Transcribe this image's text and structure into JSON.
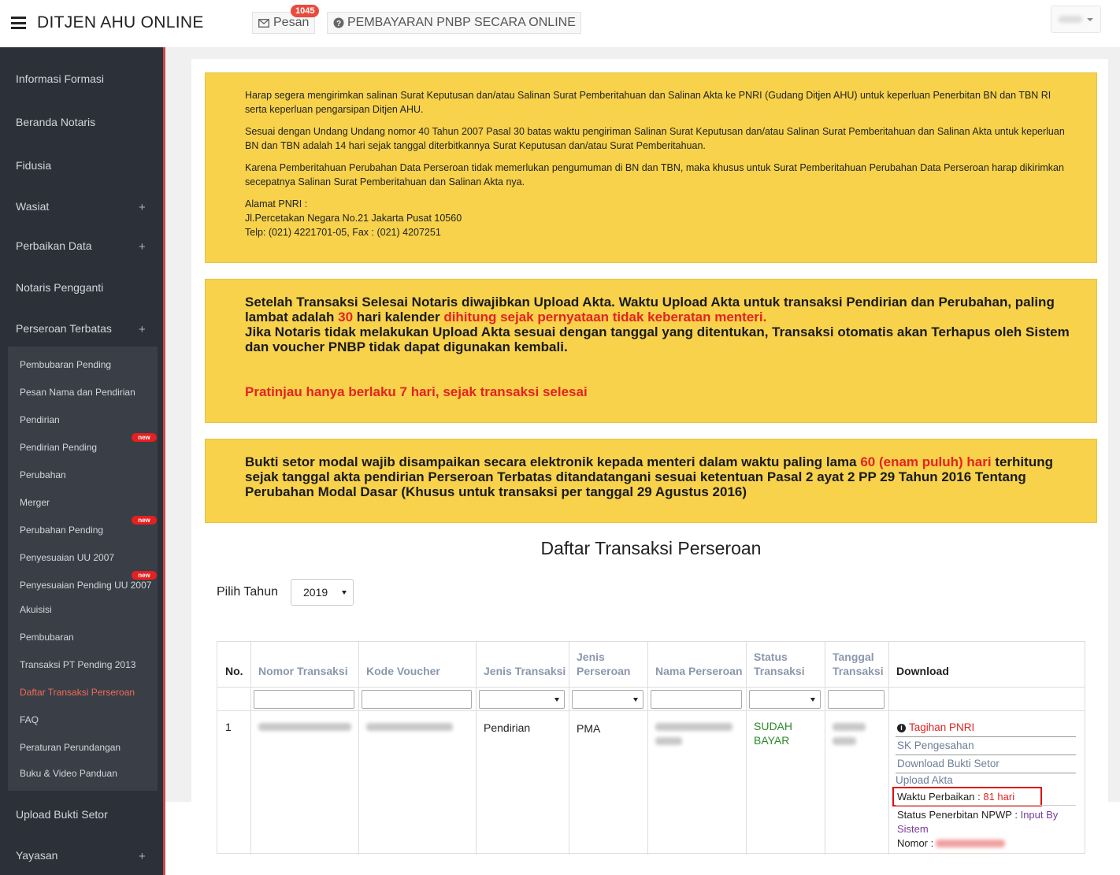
{
  "header": {
    "brand": "DITJEN AHU ONLINE",
    "messages_label": "Pesan",
    "messages_count": "1045",
    "pnbp_label": "PEMBAYARAN PNBP SECARA ONLINE"
  },
  "sidebar": {
    "items": [
      {
        "label": "Informasi Formasi"
      },
      {
        "label": "Beranda Notaris"
      },
      {
        "label": "Fidusia"
      },
      {
        "label": "Wasiat",
        "expand": "+"
      },
      {
        "label": "Perbaikan Data",
        "expand": "+"
      },
      {
        "label": "Notaris Pengganti"
      },
      {
        "label": "Perseroan Terbatas",
        "expand": "+"
      }
    ],
    "submenu": [
      {
        "label": "Pembubaran Pending"
      },
      {
        "label": "Pesan Nama dan Pendirian"
      },
      {
        "label": "Pendirian"
      },
      {
        "label": "Pendirian Pending",
        "badge": "new"
      },
      {
        "label": "Perubahan"
      },
      {
        "label": "Merger"
      },
      {
        "label": "Perubahan Pending",
        "badge": "new"
      },
      {
        "label": "Penyesuaian UU 2007"
      },
      {
        "label": "Penyesuaian Pending UU 2007",
        "badge": "new"
      },
      {
        "label": "Akuisisi"
      },
      {
        "label": "Pembubaran"
      },
      {
        "label": "Transaksi PT Pending 2013"
      },
      {
        "label": "Daftar Transaksi Perseroan",
        "active": true
      },
      {
        "label": "FAQ"
      },
      {
        "label": "Peraturan Perundangan"
      },
      {
        "label": "Buku & Video Panduan"
      }
    ],
    "after": [
      {
        "label": "Upload Bukti Setor"
      },
      {
        "label": "Yayasan",
        "expand": "+"
      }
    ]
  },
  "notice1": {
    "p1": "Harap segera mengirimkan salinan Surat Keputusan dan/atau Salinan Surat Pemberitahuan dan Salinan Akta ke PNRI (Gudang Ditjen AHU) untuk keperluan Penerbitan BN dan TBN RI serta keperluan pengarsipan Ditjen AHU.",
    "p2": "Sesuai dengan Undang Undang nomor 40 Tahun 2007 Pasal 30 batas waktu pengiriman Salinan Surat Keputusan dan/atau Salinan Surat Pemberitahuan dan Salinan Akta untuk keperluan BN dan TBN adalah 14 hari sejak tanggal diterbitkannya Surat Keputusan dan/atau Surat Pemberitahuan.",
    "p3": "Karena Pemberitahuan Perubahan Data Perseroan tidak memerlukan pengumuman di BN dan TBN, maka khusus untuk Surat Pemberitahuan Perubahan Data Perseroan harap dikirimkan secepatnya Salinan Surat Pemberitahuan dan Salinan Akta nya.",
    "addr_title": "Alamat PNRI :",
    "addr_line1": "Jl.Percetakan Negara No.21 Jakarta Pusat 10560",
    "addr_line2": "Telp: (021) 4221701-05, Fax : (021) 4207251"
  },
  "notice2": {
    "t1": "Setelah Transaksi Selesai Notaris diwajibkan Upload Akta. Waktu Upload Akta untuk transaksi Pendirian dan Perubahan, paling lambat adalah ",
    "t_days": "30",
    "t2": " hari kalender ",
    "t_red": "dihitung sejak pernyataan tidak keberatan menteri.",
    "t3": "Jika Notaris tidak melakukan Upload Akta sesuai dengan tanggal yang ditentukan, Transaksi otomatis akan Terhapus oleh Sistem dan voucher PNBP tidak dapat digunakan kembali.",
    "preview": "Pratinjau hanya berlaku 7 hari, sejak transaksi selesai"
  },
  "notice3": {
    "t1": "Bukti setor modal wajib disampaikan secara elektronik kepada menteri dalam waktu paling lama ",
    "t_red": "60 (enam puluh) hari",
    "t2": " terhitung sejak tanggal akta pendirian Perseroan Terbatas ditandatangani sesuai ketentuan Pasal 2 ayat 2 PP 29 Tahun 2016 Tentang Perubahan Modal Dasar (Khusus untuk transaksi per tanggal 29 Agustus 2016)"
  },
  "list": {
    "title": "Daftar Transaksi Perseroan",
    "year_label": "Pilih Tahun",
    "year_value": "2019"
  },
  "table": {
    "headers": {
      "no": "No.",
      "nomor": "Nomor Transaksi",
      "kode": "Kode Voucher",
      "jenis": "Jenis Transaksi",
      "jenis_perseroan_1": "Jenis",
      "jenis_perseroan_2": "Perseroan",
      "nama": "Nama Perseroan",
      "status_1": "Status",
      "status_2": "Transaksi",
      "tanggal_1": "Tanggal",
      "tanggal_2": "Transaksi",
      "download": "Download"
    },
    "row": {
      "no": "1",
      "jenis": "Pendirian",
      "jenis_perseroan": "PMA",
      "status_1": "SUDAH",
      "status_2": "BAYAR",
      "tagihan": "Tagihan PNRI",
      "sk": "SK Pengesahan",
      "bukti": "Download Bukti Setor",
      "upload": "Upload Akta",
      "waktu_label": "Waktu Perbaikan :",
      "waktu_value": "81 hari",
      "npwp_label": "Status Penerbitan NPWP :",
      "npwp_value_1": "Input By",
      "npwp_value_2": "Sistem",
      "nomor_label": "Nomor :"
    }
  },
  "colors": {
    "sidebar": "#2c3038",
    "submenu": "#3a3e47",
    "accent_red": "#e52222",
    "notice_yellow": "#f7d24a",
    "active_link": "#ef6c57"
  }
}
